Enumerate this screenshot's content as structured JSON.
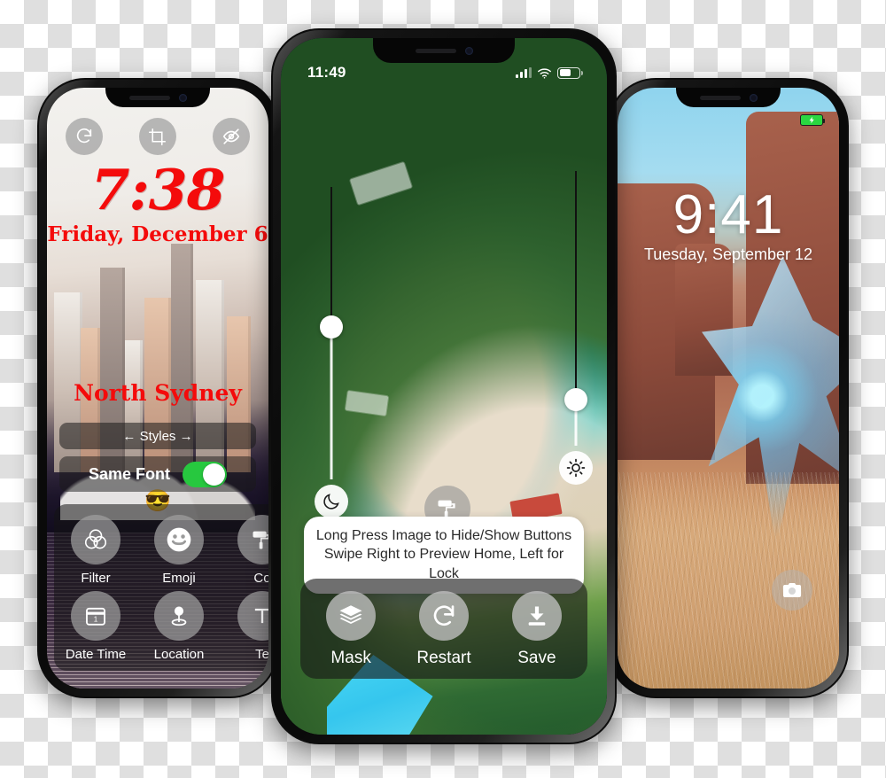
{
  "background": {
    "type": "transparency-checkerboard",
    "light": "#ffffff",
    "dark": "#dfdfdf"
  },
  "left_phone": {
    "accent_color": "#f40b0b",
    "wallpaper": "sydney-opera-house-skyline",
    "top_tools": [
      {
        "name": "rotate-icon",
        "label": "Rotate"
      },
      {
        "name": "crop-icon",
        "label": "Crop"
      },
      {
        "name": "eye-slash-icon",
        "label": "Hide"
      }
    ],
    "time": "7:38",
    "date": "Friday, December 6",
    "place": "North Sydney",
    "styles_label": "← Styles →",
    "same_font_label": "Same Font",
    "same_font_on": true,
    "emoji": "😎",
    "tools": [
      {
        "label": "Filter",
        "icon": "venn-filter-icon"
      },
      {
        "label": "Emoji",
        "icon": "smiley-icon"
      },
      {
        "label": "Co",
        "icon": "paint-roller-icon"
      },
      {
        "label": "Date Time",
        "icon": "calendar-icon"
      },
      {
        "label": "Location",
        "icon": "location-pin-icon"
      },
      {
        "label": "Te",
        "icon": "text-icon"
      }
    ]
  },
  "center_phone": {
    "wallpaper": "aerial-beach-turquoise-lagoon",
    "status": {
      "time": "11:49",
      "signal": "signal-bars-icon",
      "wifi": "wifi-icon",
      "battery": "battery-icon"
    },
    "sliders": [
      {
        "name": "night-slider",
        "icon": "moon-icon",
        "position_pct": 47
      },
      {
        "name": "brightness-slider",
        "icon": "sun-icon",
        "position_pct": 82
      }
    ],
    "roller_button": {
      "name": "paint-roller-button",
      "icon": "paint-roller-icon"
    },
    "tooltip": {
      "line1": "Long Press Image to Hide/Show Buttons",
      "line2": "Swipe Right to Preview Home, Left for Lock"
    },
    "actions": [
      {
        "label": "Mask",
        "icon": "layers-icon"
      },
      {
        "label": "Restart",
        "icon": "restart-icon"
      },
      {
        "label": "Save",
        "icon": "download-icon"
      }
    ]
  },
  "right_phone": {
    "wallpaper": "canyon-crystal-landscape",
    "battery_status": "charging",
    "time": "9:41",
    "date": "Tuesday, September 12",
    "camera_button": {
      "name": "camera-button",
      "icon": "camera-icon"
    }
  }
}
